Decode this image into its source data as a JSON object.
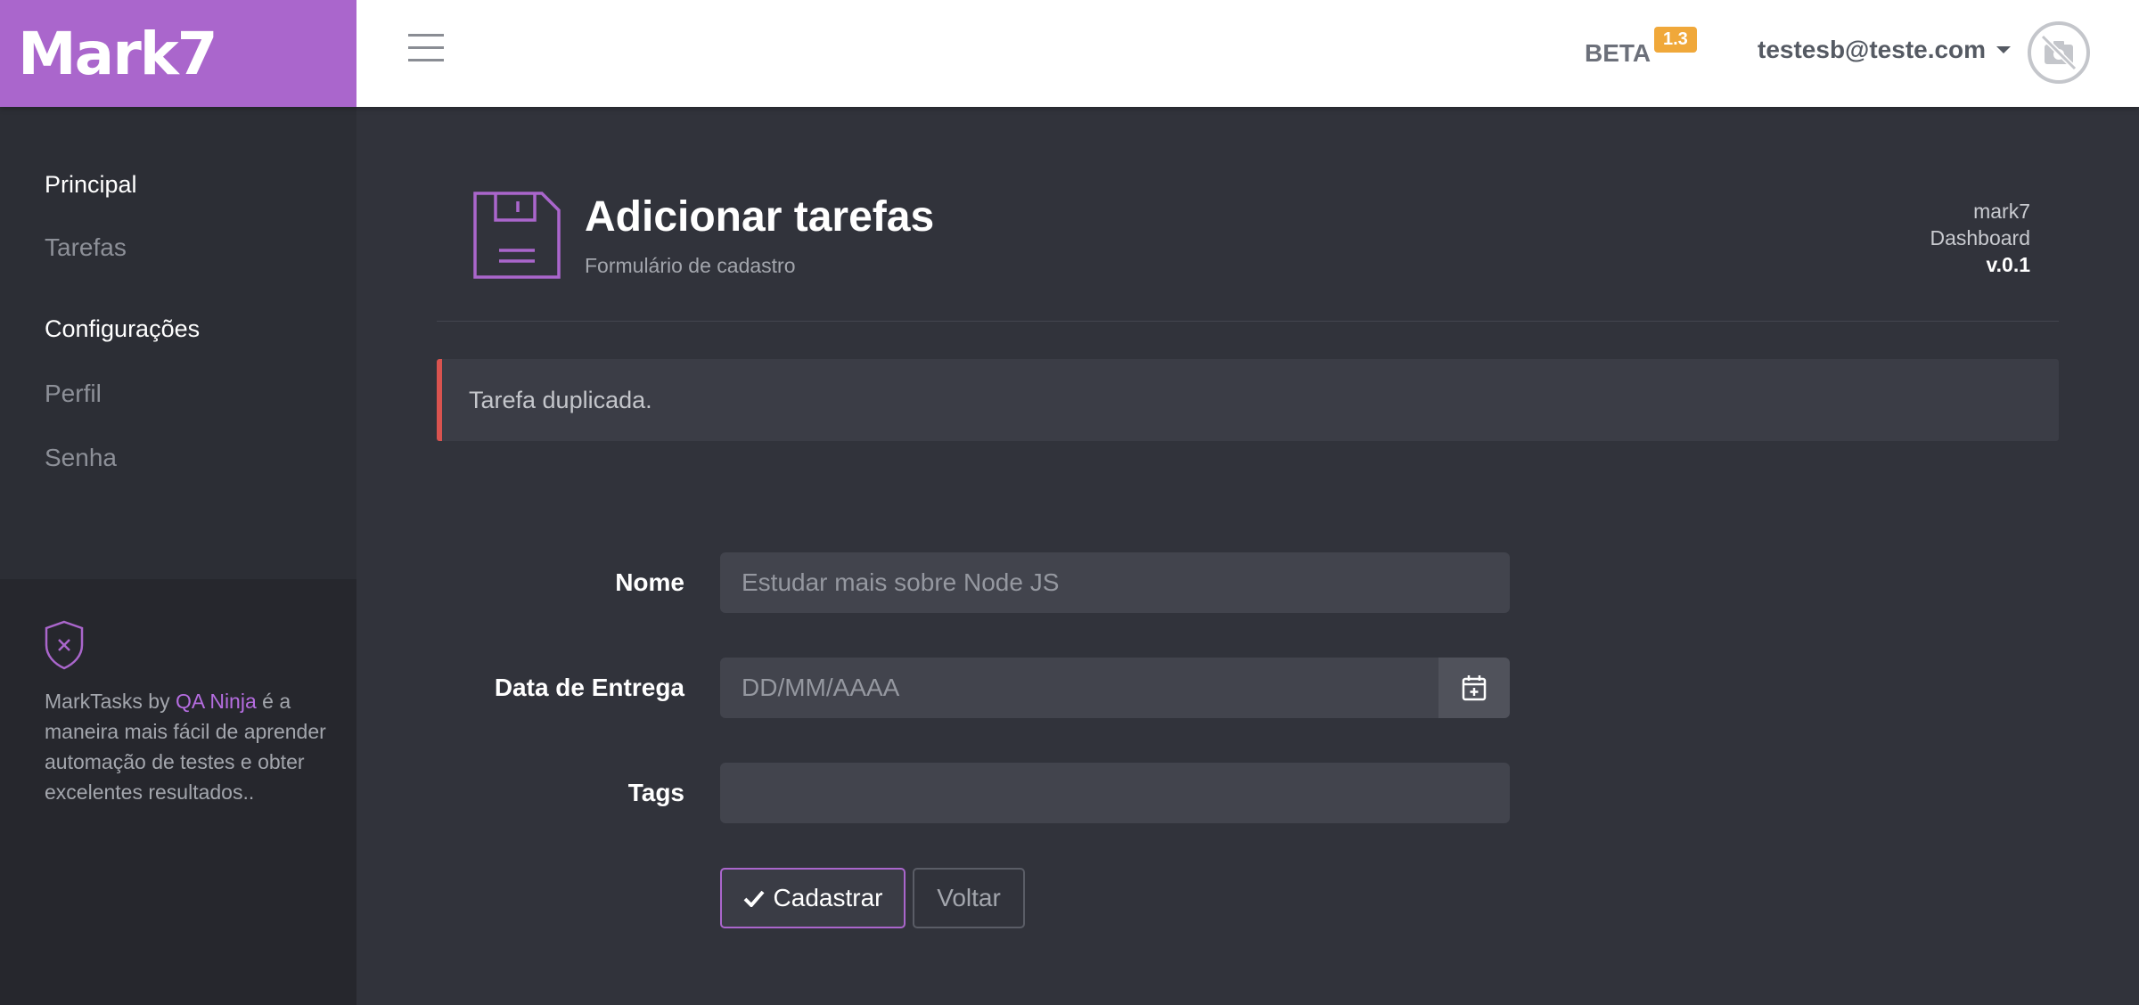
{
  "brand": {
    "name": "Mark7"
  },
  "header": {
    "beta_label": "BETA",
    "beta_version": "1.3",
    "user_email": "testesb@teste.com"
  },
  "sidebar": {
    "sections": [
      {
        "title": "Principal",
        "items": [
          {
            "label": "Tarefas"
          }
        ]
      },
      {
        "title": "Configurações",
        "items": [
          {
            "label": "Perfil"
          },
          {
            "label": "Senha"
          }
        ]
      }
    ],
    "footer": {
      "prefix": "MarkTasks by ",
      "link": "QA Ninja",
      "suffix": " é a maneira mais fácil de aprender automação de testes e obter excelentes resultados.."
    }
  },
  "page": {
    "title": "Adicionar tarefas",
    "subtitle": "Formulário de cadastro",
    "meta_app": "mark7",
    "meta_section": "Dashboard",
    "meta_version": "v.0.1"
  },
  "alert": {
    "message": "Tarefa duplicada."
  },
  "form": {
    "name_label": "Nome",
    "name_placeholder": "Estudar mais sobre Node JS",
    "date_label": "Data de Entrega",
    "date_placeholder": "DD/MM/AAAA",
    "tags_label": "Tags",
    "tags_value": "",
    "submit_label": "Cadastrar",
    "back_label": "Voltar"
  },
  "colors": {
    "brand": "#aa66cc",
    "alert_border": "#d9534f",
    "badge": "#f0a83a"
  },
  "icons": [
    "menu-icon",
    "no-photo-icon",
    "floppy-disk-icon",
    "shield-x-icon",
    "calendar-plus-icon",
    "check-icon"
  ]
}
